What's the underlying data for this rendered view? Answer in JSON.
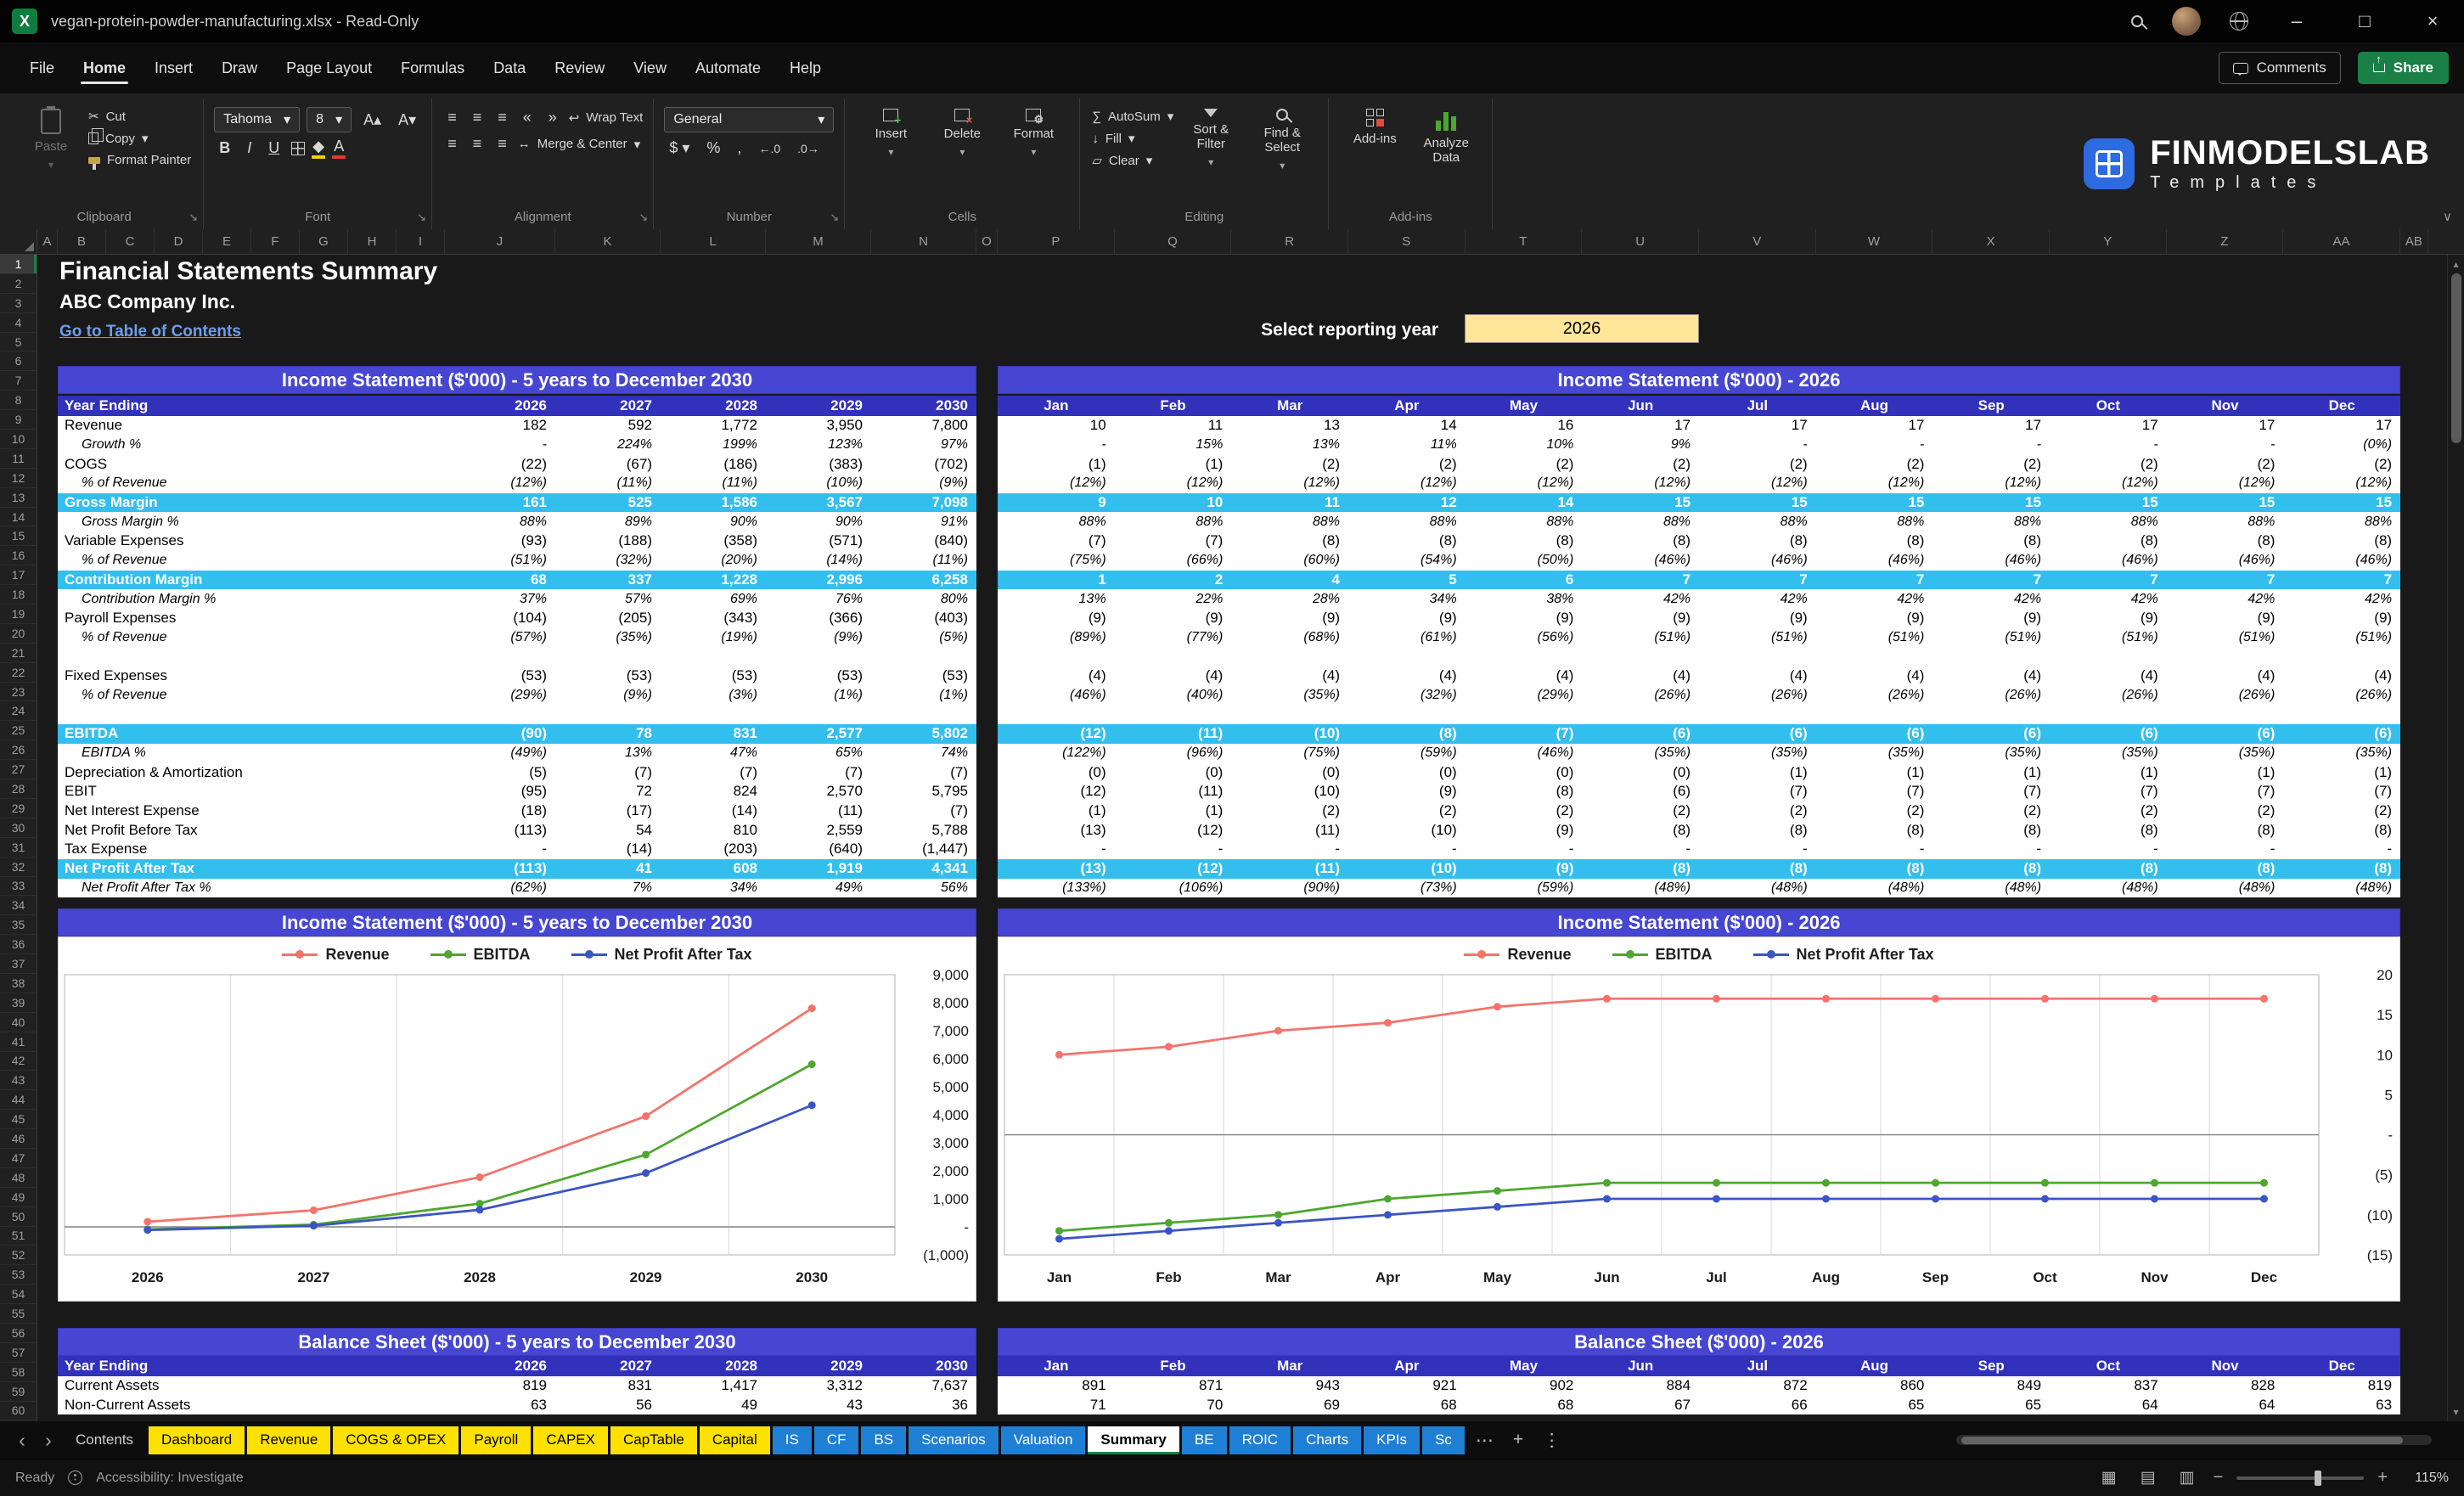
{
  "window": {
    "title": "vegan-protein-powder-manufacturing.xlsx  -  Read-Only",
    "app_icon_letter": "X"
  },
  "icons": {
    "minimize": "–",
    "maximize": "□",
    "close": "×",
    "tab_prev": "‹",
    "tab_next": "›",
    "tab_more": "⋯",
    "tab_add": "+",
    "tab_kebab": "⋮",
    "collapse_ribbon": "∨",
    "launcher": "↘",
    "dropdown": "▾",
    "autosum": "∑",
    "fill": "↓",
    "clear": "▱",
    "wrap": "↩",
    "merge": "↔",
    "align_lines": "≡",
    "indent_left": "«",
    "indent_right": "»",
    "currency": "$",
    "percent": "%",
    "comma": ",",
    "inc_decimal": "←.0",
    "dec_decimal": ".0→",
    "grow_font": "A▴",
    "shrink_font": "A▾",
    "view_normal": "▦",
    "view_layout": "▤",
    "view_break": "▥",
    "scissors": "✂"
  },
  "menus": [
    "File",
    "Home",
    "Insert",
    "Draw",
    "Page Layout",
    "Formulas",
    "Data",
    "Review",
    "View",
    "Automate",
    "Help"
  ],
  "active_menu": "Home",
  "topbar": {
    "comments": "Comments",
    "share": "Share"
  },
  "ribbon": {
    "groups": {
      "clipboard": "Clipboard",
      "font": "Font",
      "alignment": "Alignment",
      "number": "Number",
      "cells": "Cells",
      "editing": "Editing",
      "addins": "Add-ins"
    },
    "paste": "Paste",
    "cut": "Cut",
    "copy": "Copy",
    "format_painter": "Format Painter",
    "font_name": "Tahoma",
    "font_size": "8",
    "bold": "B",
    "italic": "I",
    "underline": "U",
    "wrap_text": "Wrap Text",
    "merge_center": "Merge & Center",
    "number_format": "General",
    "insert": "Insert",
    "delete": "Delete",
    "format": "Format",
    "autosum": "AutoSum",
    "fill": "Fill",
    "clear": "Clear",
    "sort_filter": "Sort & Filter",
    "find_select": "Find & Select",
    "addins_label": "Add-ins",
    "analyze_data": "Analyze Data"
  },
  "brand": {
    "name": "FINMODELSLAB",
    "sub": "Templates"
  },
  "grid": {
    "column_letters": [
      "A",
      "B",
      "C",
      "D",
      "E",
      "F",
      "G",
      "H",
      "I",
      "J",
      "K",
      "L",
      "M",
      "N",
      "O",
      "P",
      "Q",
      "R",
      "S",
      "T",
      "U",
      "V",
      "W",
      "X",
      "Y",
      "Z",
      "AA",
      "AB"
    ],
    "row_count": 60,
    "selected_row": 1
  },
  "sheet": {
    "title": "Financial Statements Summary",
    "company": "ABC Company Inc.",
    "toc": "Go to Table of Contents",
    "year_label": "Select reporting year",
    "year_value": "2026"
  },
  "income_statement": {
    "annual_title": "Income Statement ($'000) - 5 years to December 2030",
    "monthly_title": "Income Statement ($'000) - 2026",
    "annual_header": [
      "Year Ending",
      "2026",
      "2027",
      "2028",
      "2029",
      "2030"
    ],
    "months": [
      "Jan",
      "Feb",
      "Mar",
      "Apr",
      "May",
      "Jun",
      "Jul",
      "Aug",
      "Sep",
      "Oct",
      "Nov",
      "Dec"
    ],
    "rows": [
      {
        "label": "Revenue",
        "style": "normal",
        "annual": [
          "182",
          "592",
          "1,772",
          "3,950",
          "7,800"
        ],
        "monthly": [
          "10",
          "11",
          "13",
          "14",
          "16",
          "17",
          "17",
          "17",
          "17",
          "17",
          "17",
          "17"
        ]
      },
      {
        "label": "Growth %",
        "style": "pct",
        "annual": [
          "-",
          "224%",
          "199%",
          "123%",
          "97%"
        ],
        "monthly": [
          "-",
          "15%",
          "13%",
          "11%",
          "10%",
          "9%",
          "-",
          "-",
          "-",
          "-",
          "-",
          "(0%)"
        ]
      },
      {
        "label": "COGS",
        "style": "normal",
        "annual": [
          "(22)",
          "(67)",
          "(186)",
          "(383)",
          "(702)"
        ],
        "monthly": [
          "(1)",
          "(1)",
          "(2)",
          "(2)",
          "(2)",
          "(2)",
          "(2)",
          "(2)",
          "(2)",
          "(2)",
          "(2)",
          "(2)"
        ]
      },
      {
        "label": "% of Revenue",
        "style": "pct",
        "annual": [
          "(12%)",
          "(11%)",
          "(11%)",
          "(10%)",
          "(9%)"
        ],
        "monthly": [
          "(12%)",
          "(12%)",
          "(12%)",
          "(12%)",
          "(12%)",
          "(12%)",
          "(12%)",
          "(12%)",
          "(12%)",
          "(12%)",
          "(12%)",
          "(12%)"
        ]
      },
      {
        "label": "Gross Margin",
        "style": "highlight",
        "annual": [
          "161",
          "525",
          "1,586",
          "3,567",
          "7,098"
        ],
        "monthly": [
          "9",
          "10",
          "11",
          "12",
          "14",
          "15",
          "15",
          "15",
          "15",
          "15",
          "15",
          "15"
        ]
      },
      {
        "label": "Gross Margin %",
        "style": "pct",
        "annual": [
          "88%",
          "89%",
          "90%",
          "90%",
          "91%"
        ],
        "monthly": [
          "88%",
          "88%",
          "88%",
          "88%",
          "88%",
          "88%",
          "88%",
          "88%",
          "88%",
          "88%",
          "88%",
          "88%"
        ]
      },
      {
        "label": "Variable Expenses",
        "style": "normal",
        "annual": [
          "(93)",
          "(188)",
          "(358)",
          "(571)",
          "(840)"
        ],
        "monthly": [
          "(7)",
          "(7)",
          "(8)",
          "(8)",
          "(8)",
          "(8)",
          "(8)",
          "(8)",
          "(8)",
          "(8)",
          "(8)",
          "(8)"
        ]
      },
      {
        "label": "% of Revenue",
        "style": "pct",
        "annual": [
          "(51%)",
          "(32%)",
          "(20%)",
          "(14%)",
          "(11%)"
        ],
        "monthly": [
          "(75%)",
          "(66%)",
          "(60%)",
          "(54%)",
          "(50%)",
          "(46%)",
          "(46%)",
          "(46%)",
          "(46%)",
          "(46%)",
          "(46%)",
          "(46%)"
        ]
      },
      {
        "label": "Contribution Margin",
        "style": "highlight",
        "annual": [
          "68",
          "337",
          "1,228",
          "2,996",
          "6,258"
        ],
        "monthly": [
          "1",
          "2",
          "4",
          "5",
          "6",
          "7",
          "7",
          "7",
          "7",
          "7",
          "7",
          "7"
        ]
      },
      {
        "label": "Contribution Margin %",
        "style": "pct",
        "annual": [
          "37%",
          "57%",
          "69%",
          "76%",
          "80%"
        ],
        "monthly": [
          "13%",
          "22%",
          "28%",
          "34%",
          "38%",
          "42%",
          "42%",
          "42%",
          "42%",
          "42%",
          "42%",
          "42%"
        ]
      },
      {
        "label": "Payroll Expenses",
        "style": "normal",
        "annual": [
          "(104)",
          "(205)",
          "(343)",
          "(366)",
          "(403)"
        ],
        "monthly": [
          "(9)",
          "(9)",
          "(9)",
          "(9)",
          "(9)",
          "(9)",
          "(9)",
          "(9)",
          "(9)",
          "(9)",
          "(9)",
          "(9)"
        ]
      },
      {
        "label": "% of Revenue",
        "style": "pct",
        "annual": [
          "(57%)",
          "(35%)",
          "(19%)",
          "(9%)",
          "(5%)"
        ],
        "monthly": [
          "(89%)",
          "(77%)",
          "(68%)",
          "(61%)",
          "(56%)",
          "(51%)",
          "(51%)",
          "(51%)",
          "(51%)",
          "(51%)",
          "(51%)",
          "(51%)"
        ]
      },
      {
        "label": "",
        "style": "blank",
        "annual": [
          "",
          "",
          "",
          "",
          ""
        ],
        "monthly": [
          "",
          "",
          "",
          "",
          "",
          "",
          "",
          "",
          "",
          "",
          "",
          ""
        ]
      },
      {
        "label": "Fixed Expenses",
        "style": "normal",
        "annual": [
          "(53)",
          "(53)",
          "(53)",
          "(53)",
          "(53)"
        ],
        "monthly": [
          "(4)",
          "(4)",
          "(4)",
          "(4)",
          "(4)",
          "(4)",
          "(4)",
          "(4)",
          "(4)",
          "(4)",
          "(4)",
          "(4)"
        ]
      },
      {
        "label": "% of Revenue",
        "style": "pct",
        "annual": [
          "(29%)",
          "(9%)",
          "(3%)",
          "(1%)",
          "(1%)"
        ],
        "monthly": [
          "(46%)",
          "(40%)",
          "(35%)",
          "(32%)",
          "(29%)",
          "(26%)",
          "(26%)",
          "(26%)",
          "(26%)",
          "(26%)",
          "(26%)",
          "(26%)"
        ]
      },
      {
        "label": "",
        "style": "blank",
        "annual": [
          "",
          "",
          "",
          "",
          ""
        ],
        "monthly": [
          "",
          "",
          "",
          "",
          "",
          "",
          "",
          "",
          "",
          "",
          "",
          ""
        ]
      },
      {
        "label": "EBITDA",
        "style": "highlight",
        "annual": [
          "(90)",
          "78",
          "831",
          "2,577",
          "5,802"
        ],
        "monthly": [
          "(12)",
          "(11)",
          "(10)",
          "(8)",
          "(7)",
          "(6)",
          "(6)",
          "(6)",
          "(6)",
          "(6)",
          "(6)",
          "(6)"
        ]
      },
      {
        "label": "EBITDA %",
        "style": "pct",
        "annual": [
          "(49%)",
          "13%",
          "47%",
          "65%",
          "74%"
        ],
        "monthly": [
          "(122%)",
          "(96%)",
          "(75%)",
          "(59%)",
          "(46%)",
          "(35%)",
          "(35%)",
          "(35%)",
          "(35%)",
          "(35%)",
          "(35%)",
          "(35%)"
        ]
      },
      {
        "label": "Depreciation & Amortization",
        "style": "normal",
        "annual": [
          "(5)",
          "(7)",
          "(7)",
          "(7)",
          "(7)"
        ],
        "monthly": [
          "(0)",
          "(0)",
          "(0)",
          "(0)",
          "(0)",
          "(0)",
          "(1)",
          "(1)",
          "(1)",
          "(1)",
          "(1)",
          "(1)"
        ]
      },
      {
        "label": "EBIT",
        "style": "normal",
        "annual": [
          "(95)",
          "72",
          "824",
          "2,570",
          "5,795"
        ],
        "monthly": [
          "(12)",
          "(11)",
          "(10)",
          "(9)",
          "(8)",
          "(6)",
          "(7)",
          "(7)",
          "(7)",
          "(7)",
          "(7)",
          "(7)"
        ]
      },
      {
        "label": "Net Interest Expense",
        "style": "normal",
        "annual": [
          "(18)",
          "(17)",
          "(14)",
          "(11)",
          "(7)"
        ],
        "monthly": [
          "(1)",
          "(1)",
          "(2)",
          "(2)",
          "(2)",
          "(2)",
          "(2)",
          "(2)",
          "(2)",
          "(2)",
          "(2)",
          "(2)"
        ]
      },
      {
        "label": "Net Profit Before Tax",
        "style": "normal",
        "annual": [
          "(113)",
          "54",
          "810",
          "2,559",
          "5,788"
        ],
        "monthly": [
          "(13)",
          "(12)",
          "(11)",
          "(10)",
          "(9)",
          "(8)",
          "(8)",
          "(8)",
          "(8)",
          "(8)",
          "(8)",
          "(8)"
        ]
      },
      {
        "label": "Tax Expense",
        "style": "normal",
        "annual": [
          "-",
          "(14)",
          "(203)",
          "(640)",
          "(1,447)"
        ],
        "monthly": [
          "-",
          "-",
          "-",
          "-",
          "-",
          "-",
          "-",
          "-",
          "-",
          "-",
          "-",
          "-"
        ]
      },
      {
        "label": "Net Profit After Tax",
        "style": "highlight",
        "annual": [
          "(113)",
          "41",
          "608",
          "1,919",
          "4,341"
        ],
        "monthly": [
          "(13)",
          "(12)",
          "(11)",
          "(10)",
          "(9)",
          "(8)",
          "(8)",
          "(8)",
          "(8)",
          "(8)",
          "(8)",
          "(8)"
        ]
      },
      {
        "label": "Net Profit After Tax %",
        "style": "pct",
        "annual": [
          "(62%)",
          "7%",
          "34%",
          "49%",
          "56%"
        ],
        "monthly": [
          "(133%)",
          "(106%)",
          "(90%)",
          "(73%)",
          "(59%)",
          "(48%)",
          "(48%)",
          "(48%)",
          "(48%)",
          "(48%)",
          "(48%)",
          "(48%)"
        ]
      }
    ]
  },
  "balance_sheet": {
    "annual_title": "Balance Sheet ($'000) - 5 years to December 2030",
    "monthly_title": "Balance Sheet ($'000) - 2026",
    "annual_header": [
      "Year Ending",
      "2026",
      "2027",
      "2028",
      "2029",
      "2030"
    ],
    "rows": [
      {
        "label": "Current Assets",
        "style": "normal",
        "annual": [
          "819",
          "831",
          "1,417",
          "3,312",
          "7,637"
        ],
        "monthly": [
          "891",
          "871",
          "943",
          "921",
          "902",
          "884",
          "872",
          "860",
          "849",
          "837",
          "828",
          "819"
        ]
      },
      {
        "label": "Non-Current Assets",
        "style": "normal",
        "annual": [
          "63",
          "56",
          "49",
          "43",
          "36"
        ],
        "monthly": [
          "71",
          "70",
          "69",
          "68",
          "68",
          "67",
          "66",
          "65",
          "65",
          "64",
          "64",
          "63"
        ]
      }
    ]
  },
  "chart_data": [
    {
      "type": "line",
      "title": "Income Statement ($'000) - 5 years to December 2030",
      "categories": [
        "2026",
        "2027",
        "2028",
        "2029",
        "2030"
      ],
      "series": [
        {
          "name": "Revenue",
          "color": "#f4736b",
          "values": [
            182,
            592,
            1772,
            3950,
            7800
          ]
        },
        {
          "name": "EBITDA",
          "color": "#4ea72e",
          "values": [
            -90,
            78,
            831,
            2577,
            5802
          ]
        },
        {
          "name": "Net Profit After Tax",
          "color": "#3a55c5",
          "values": [
            -113,
            41,
            608,
            1919,
            4341
          ]
        }
      ],
      "ylim": [
        -1000,
        9000
      ],
      "ytick": 1000,
      "axis_side": "right",
      "legend_position": "top",
      "grid": "vertical",
      "x_tick_bold": true
    },
    {
      "type": "line",
      "title": "Income Statement ($'000) - 2026",
      "categories": [
        "Jan",
        "Feb",
        "Mar",
        "Apr",
        "May",
        "Jun",
        "Jul",
        "Aug",
        "Sep",
        "Oct",
        "Nov",
        "Dec"
      ],
      "series": [
        {
          "name": "Revenue",
          "color": "#f4736b",
          "values": [
            10,
            11,
            13,
            14,
            16,
            17,
            17,
            17,
            17,
            17,
            17,
            17
          ]
        },
        {
          "name": "EBITDA",
          "color": "#4ea72e",
          "values": [
            -12,
            -11,
            -10,
            -8,
            -7,
            -6,
            -6,
            -6,
            -6,
            -6,
            -6,
            -6
          ]
        },
        {
          "name": "Net Profit After Tax",
          "color": "#3a55c5",
          "values": [
            -13,
            -12,
            -11,
            -10,
            -9,
            -8,
            -8,
            -8,
            -8,
            -8,
            -8,
            -8
          ]
        }
      ],
      "ylim": [
        -15,
        20
      ],
      "ytick": 5,
      "axis_side": "right",
      "legend_position": "top",
      "grid": "vertical",
      "x_tick_bold": true
    }
  ],
  "sheet_tabs": {
    "tabs": [
      {
        "label": "Contents",
        "type": "plain"
      },
      {
        "label": "Dashboard",
        "type": "yellow"
      },
      {
        "label": "Revenue",
        "type": "yellow"
      },
      {
        "label": "COGS & OPEX",
        "type": "yellow"
      },
      {
        "label": "Payroll",
        "type": "yellow"
      },
      {
        "label": "CAPEX",
        "type": "yellow"
      },
      {
        "label": "CapTable",
        "type": "yellow"
      },
      {
        "label": "Capital",
        "type": "yellow"
      },
      {
        "label": "IS",
        "type": "blue"
      },
      {
        "label": "CF",
        "type": "blue"
      },
      {
        "label": "BS",
        "type": "blue"
      },
      {
        "label": "Scenarios",
        "type": "blue"
      },
      {
        "label": "Valuation",
        "type": "blue"
      },
      {
        "label": "Summary",
        "type": "active"
      },
      {
        "label": "BE",
        "type": "blue"
      },
      {
        "label": "ROIC",
        "type": "blue"
      },
      {
        "label": "Charts",
        "type": "blue"
      },
      {
        "label": "KPIs",
        "type": "blue"
      },
      {
        "label": "Sc",
        "type": "blue"
      }
    ]
  },
  "status": {
    "ready": "Ready",
    "accessibility": "Accessibility: Investigate",
    "zoom": "115%"
  }
}
